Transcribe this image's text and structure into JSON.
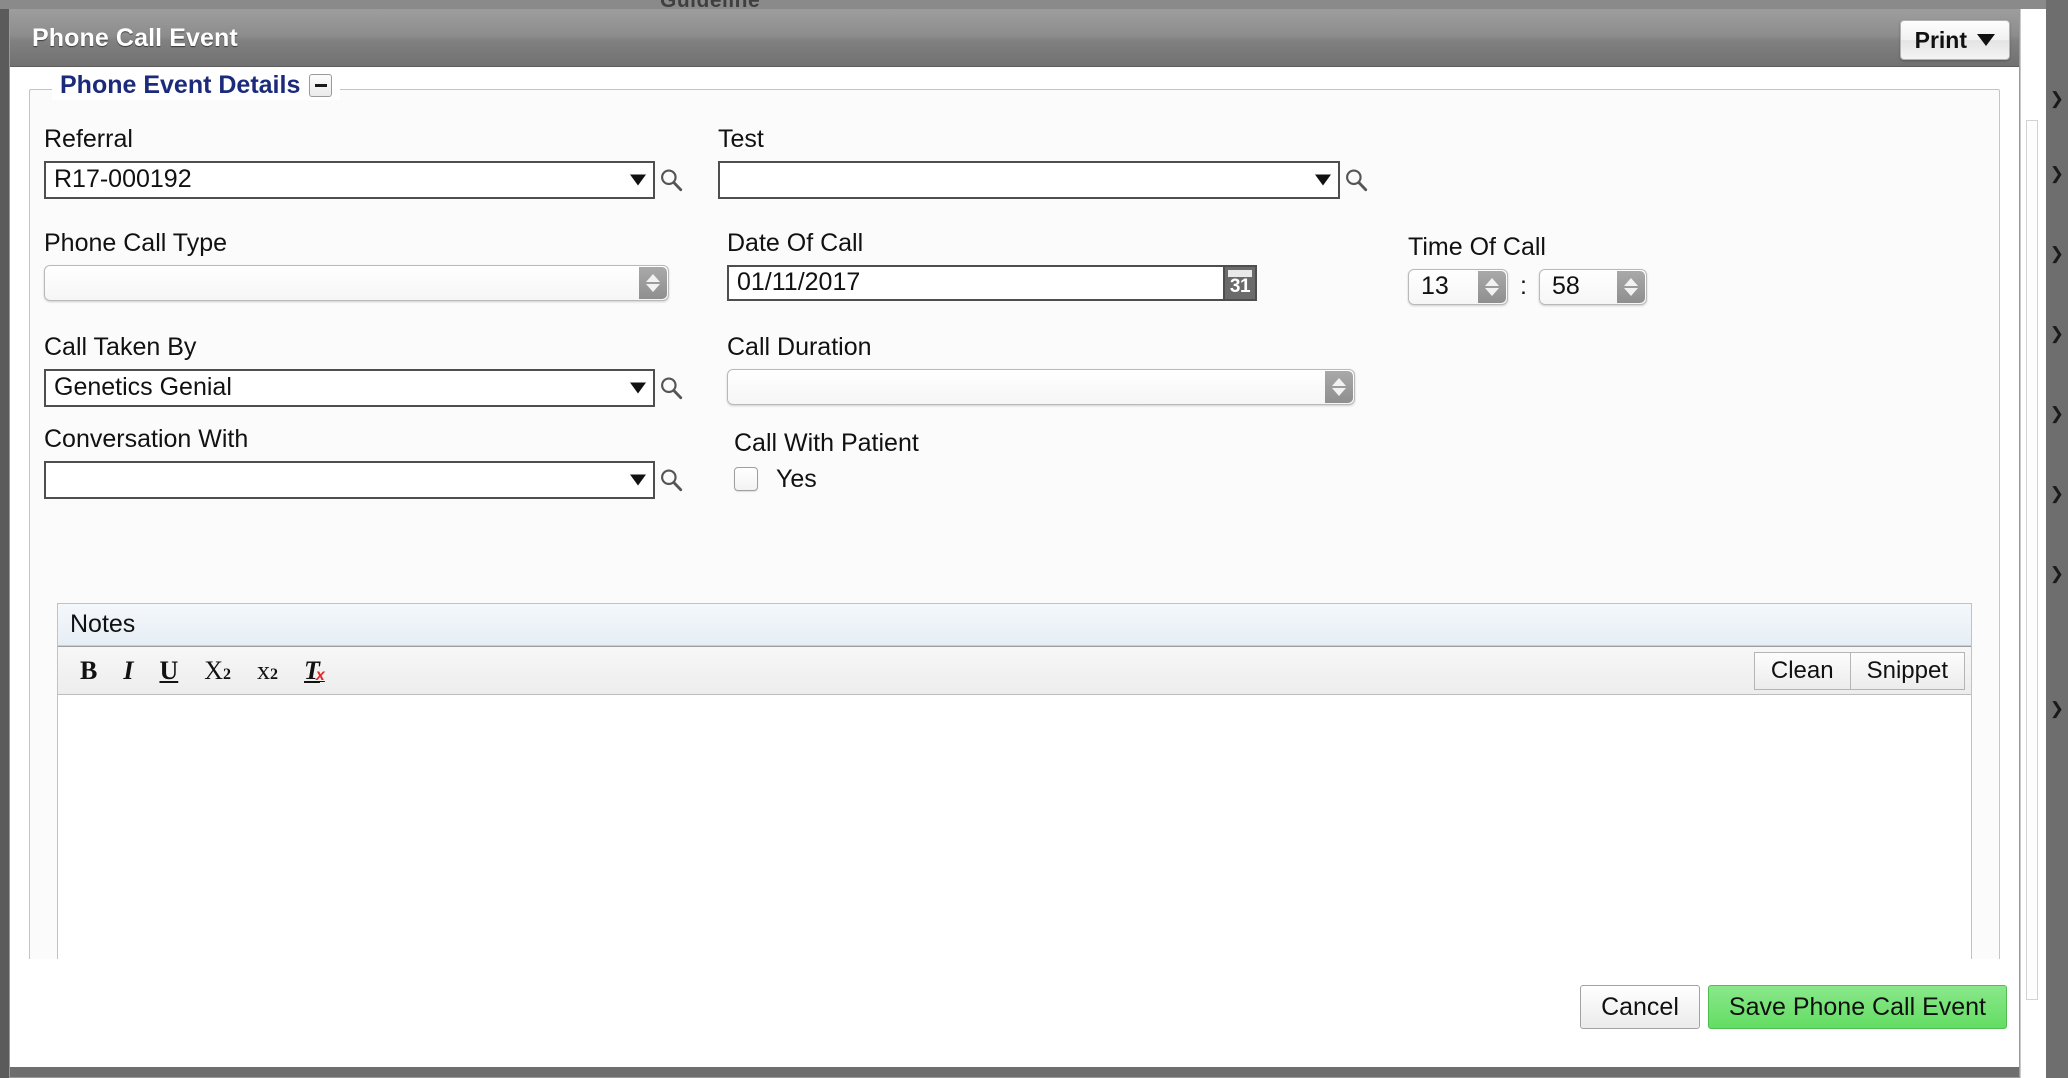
{
  "background": {
    "top_partial_text": "Guideline",
    "right_rail_icon": "chevron-right-icon"
  },
  "modal": {
    "title": "Phone Call Event",
    "print_button": "Print",
    "print_caret_icon": "caret-down-icon"
  },
  "fieldset": {
    "legend": "Phone Event Details",
    "collapse_icon": "minus-icon"
  },
  "form": {
    "referral": {
      "label": "Referral",
      "value": "R17-000192",
      "dropdown_icon": "caret-down-icon",
      "lookup_icon": "search-icon"
    },
    "test": {
      "label": "Test",
      "value": "",
      "dropdown_icon": "caret-down-icon",
      "lookup_icon": "search-icon"
    },
    "phone_call_type": {
      "label": "Phone Call Type",
      "value": "",
      "stepper_icon": "stepper-updown-icon"
    },
    "date_of_call": {
      "label": "Date Of Call",
      "value": "01/11/2017",
      "calendar_icon": "calendar-icon",
      "calendar_day": "31"
    },
    "time_of_call": {
      "label": "Time Of Call",
      "hours": "13",
      "separator": ":",
      "minutes": "58",
      "stepper_icon": "stepper-updown-icon"
    },
    "call_taken_by": {
      "label": "Call Taken By",
      "value": "Genetics Genial",
      "dropdown_icon": "caret-down-icon",
      "lookup_icon": "search-icon"
    },
    "call_duration": {
      "label": "Call Duration",
      "value": "",
      "stepper_icon": "stepper-updown-icon"
    },
    "conversation_with": {
      "label": "Conversation With",
      "value": "",
      "dropdown_icon": "caret-down-icon",
      "lookup_icon": "search-icon"
    },
    "call_with_patient": {
      "label": "Call With Patient",
      "checkbox_label": "Yes",
      "checked": false
    }
  },
  "notes": {
    "header": "Notes",
    "content": "",
    "toolbar": {
      "bold": "B",
      "italic": "I",
      "underline": "U",
      "subscript_base": "X",
      "subscript_sub": "2",
      "superscript_base": "x",
      "superscript_sup": "2",
      "remove_format": "T",
      "remove_format_x": "x",
      "clean": "Clean",
      "snippet": "Snippet"
    }
  },
  "footer": {
    "cancel": "Cancel",
    "save": "Save Phone Call Event"
  }
}
